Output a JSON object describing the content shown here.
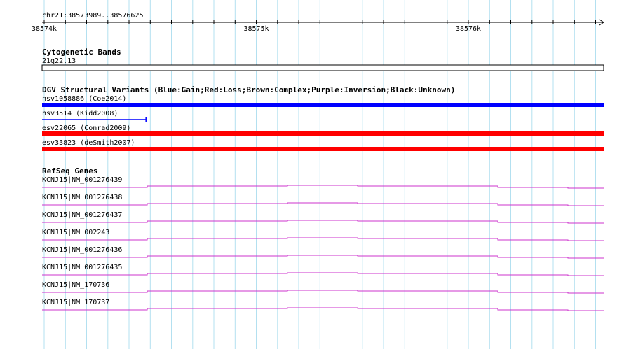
{
  "location": "chr21:38573989..38576625",
  "ruler": {
    "start": 38573989,
    "end": 38576625,
    "labels": [
      {
        "pos": 38574000,
        "text": "38574k"
      },
      {
        "pos": 38575000,
        "text": "38575k"
      },
      {
        "pos": 38576000,
        "text": "38576k"
      }
    ]
  },
  "tracks": {
    "cytoband": {
      "title": "Cytogenetic Bands",
      "band_label": "21q22.13"
    },
    "dgv": {
      "title": "DGV Structural Variants (Blue:Gain;Red:Loss;Brown:Complex;Purple:Inversion;Black:Unknown)",
      "legend_colors": {
        "gain": "#0000ff",
        "loss": "#ff0000",
        "complex": "#8b4513",
        "inversion": "#800080",
        "unknown": "#000000"
      },
      "features": [
        {
          "label": "nsv1058886 (Coe2014)",
          "type": "gain",
          "color": "#0000ff",
          "extends_past_view": true
        },
        {
          "label": "nsv3514 (Kidd2008)",
          "type": "gain",
          "color": "#0000ff",
          "end": 38574480
        },
        {
          "label": "esv22065 (Conrad2009)",
          "type": "loss",
          "color": "#ff0000",
          "extends_past_view": true
        },
        {
          "label": "esv33823 (deSmith2007)",
          "type": "loss",
          "color": "#ff0000",
          "extends_past_view": true
        }
      ]
    },
    "refseq": {
      "title": "RefSeq Genes",
      "color": "#cc33cc",
      "features": [
        {
          "label": "KCNJ15|NM_001276439"
        },
        {
          "label": "KCNJ15|NM_001276438"
        },
        {
          "label": "KCNJ15|NM_001276437"
        },
        {
          "label": "KCNJ15|NM_002243"
        },
        {
          "label": "KCNJ15|NM_001276436"
        },
        {
          "label": "KCNJ15|NM_001276435"
        },
        {
          "label": "KCNJ15|NM_170736"
        },
        {
          "label": "KCNJ15|NM_170737"
        }
      ]
    }
  },
  "colors": {
    "grid": "#b3e0f0",
    "ruler": "#000000"
  }
}
